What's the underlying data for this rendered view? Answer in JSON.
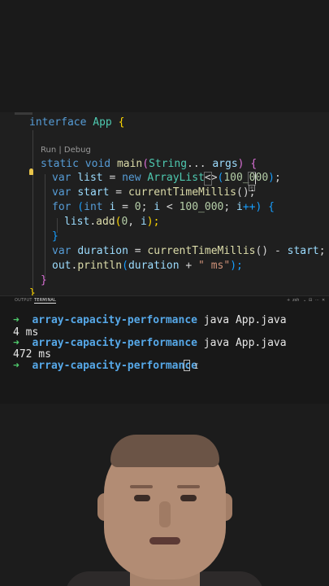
{
  "editor": {
    "codelens": "Run | Debug",
    "lines": [
      {
        "t1": "interface",
        "t2": " ",
        "t3": "App",
        "t4": " {"
      },
      {
        "t1": "static",
        "t2": " ",
        "t3": "void",
        "t4": " ",
        "t5": "main",
        "t6": "(",
        "t7": "String",
        "t8": "... ",
        "t9": "args",
        "t10": ") {"
      },
      {
        "t1": "var",
        "t2": " ",
        "t3": "list",
        "t4": " = ",
        "t5": "new",
        "t6": " ",
        "t7": "ArrayList",
        "t8": "<>",
        "t9": "(",
        "t10": "100_000",
        "t11": ")",
        "t12": ";"
      },
      {
        "t1": "var",
        "t2": " ",
        "t3": "start",
        "t4": " = ",
        "t5": "currentTimeMillis",
        "t6": "();"
      },
      {
        "t1": "for",
        "t2": " (",
        "t3": "int",
        "t4": " ",
        "t5": "i",
        "t6": " = ",
        "t7": "0",
        "t8": "; ",
        "t9": "i",
        "t10": " < ",
        "t11": "100_000",
        "t12": "; ",
        "t13": "i",
        "t14": "++) {"
      },
      {
        "t1": "list",
        "t2": ".",
        "t3": "add",
        "t4": "(",
        "t5": "0",
        "t6": ", ",
        "t7": "i",
        "t8": ");"
      },
      {
        "t1": "}"
      },
      {
        "t1": "var",
        "t2": " ",
        "t3": "duration",
        "t4": " = ",
        "t5": "currentTimeMillis",
        "t6": "() - ",
        "t7": "start",
        "t8": ";"
      },
      {
        "t1": "out",
        "t2": ".",
        "t3": "println",
        "t4": "(",
        "t5": "duration",
        "t6": " + ",
        "t7": "\" ms\"",
        "t8": ");"
      },
      {
        "t1": "}"
      },
      {
        "t1": "}"
      }
    ]
  },
  "panel": {
    "tabs": [
      "OUTPUT",
      "TERMINAL"
    ],
    "shell_label": "zsh",
    "controls": [
      "+",
      "⌄",
      "⊟",
      "🗑",
      "⋯",
      "✕"
    ]
  },
  "terminal": {
    "lines": [
      {
        "arrow": "➜",
        "dir": "array-capacity-performance",
        "cmd": " java App.java"
      },
      {
        "output": "4 ms"
      },
      {
        "arrow": "➜",
        "dir": "array-capacity-performance",
        "cmd": " java App.java"
      },
      {
        "output": "472 ms"
      },
      {
        "arrow": "➜",
        "dir": "array-capacity-performance",
        "cmd": " "
      }
    ]
  },
  "colors": {
    "keyword": "#569cd6",
    "type": "#4ec9b0",
    "function": "#dcdcaa",
    "number": "#b5cea8",
    "string": "#ce9178",
    "prompt_arrow": "#4ec96b",
    "prompt_dir": "#56a8e8"
  }
}
